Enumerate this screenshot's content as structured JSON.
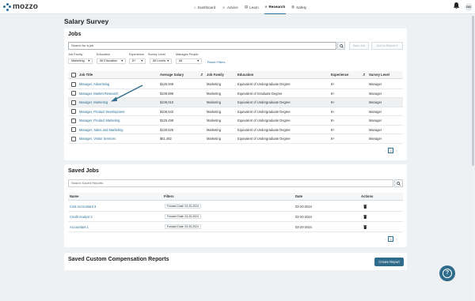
{
  "app": {
    "logo_text": "mozzo"
  },
  "nav": [
    {
      "label": "Dashboard",
      "icon": "⌂",
      "active": false
    },
    {
      "label": "Advice",
      "icon": "☺",
      "active": false
    },
    {
      "label": "Learn",
      "icon": "▤",
      "active": false
    },
    {
      "label": "Research",
      "icon": "⌕",
      "active": true
    },
    {
      "label": "Safety",
      "icon": "◍",
      "active": false
    }
  ],
  "user": {
    "initials": "DS"
  },
  "page": {
    "title": "Salary Survey"
  },
  "jobs": {
    "title": "Jobs",
    "search_value": "Search for a job",
    "save_job_label": "Save Job",
    "add_to_report_label": "Add to Report",
    "filters": [
      {
        "label": "Job Family",
        "value": "Marketing"
      },
      {
        "label": "Education",
        "value": "All Education"
      },
      {
        "label": "Experience",
        "value": "8+"
      },
      {
        "label": "Survey Level",
        "value": "All Levels"
      },
      {
        "label": "Manages People",
        "value": "All"
      }
    ],
    "reset_label": "Reset Filters",
    "columns": [
      "Job Title",
      "Average Salary",
      "Job Family",
      "Education",
      "Experience",
      "Survey Level"
    ],
    "rows": [
      {
        "title": "Manager, Advertising",
        "salary": "$126,949",
        "family": "Marketing",
        "education": "Equivalent of Undergraduate Degree",
        "experience": "8+",
        "level": "Manager"
      },
      {
        "title": "Manager, Market Research",
        "salary": "$108,898",
        "family": "Marketing",
        "education": "Equivalent of Graduate Degree",
        "experience": "8+",
        "level": "Manager"
      },
      {
        "title": "Manager, Marketing",
        "salary": "$108,010",
        "family": "Marketing",
        "education": "Equivalent of Undergraduate Degree",
        "experience": "8+",
        "level": "Manager"
      },
      {
        "title": "Manager, Product Development",
        "salary": "$108,542",
        "family": "Marketing",
        "education": "Equivalent of Undergraduate Degree",
        "experience": "8+",
        "level": "Manager"
      },
      {
        "title": "Manager, Product Marketing",
        "salary": "$125,498",
        "family": "Marketing",
        "education": "Equivalent of Undergraduate Degree",
        "experience": "8+",
        "level": "Manager"
      },
      {
        "title": "Manager, Sales and Marketing",
        "salary": "$130,626",
        "family": "Marketing",
        "education": "Equivalent of Undergraduate Degree",
        "experience": "8+",
        "level": "Manager"
      },
      {
        "title": "Manager, Visitor Services",
        "salary": "$61,482",
        "family": "Marketing",
        "education": "Equivalent of Undergraduate Degree",
        "experience": "8+",
        "level": "Manager"
      }
    ],
    "pager": {
      "prev": "‹",
      "page": "1",
      "next": "›"
    }
  },
  "saved_jobs": {
    "title": "Saved Jobs",
    "search_placeholder": "Search Saved Reports",
    "columns": [
      "Name",
      "Filters",
      "Date",
      "Actions"
    ],
    "rows": [
      {
        "name": "Cost Accountant 3",
        "filter": "Forward Date: 03-20-2024",
        "date": "03-20-2024"
      },
      {
        "name": "Credit Analyst 2",
        "filter": "Forward Date: 03-20-2024",
        "date": "03-20-2024"
      },
      {
        "name": "Accountant 1",
        "filter": "Forward Date: 03-20-2024",
        "date": "03-20-2024"
      }
    ],
    "pager": {
      "prev": "‹",
      "page": "1",
      "next": "›"
    }
  },
  "custom_reports": {
    "title": "Saved Custom Compensation Reports",
    "create_label": "Create Report"
  },
  "help": {
    "glyph": "?"
  },
  "colors": {
    "accent": "#2a6f97",
    "button": "#2f6b8a",
    "page_bg": "#eef1f4"
  }
}
